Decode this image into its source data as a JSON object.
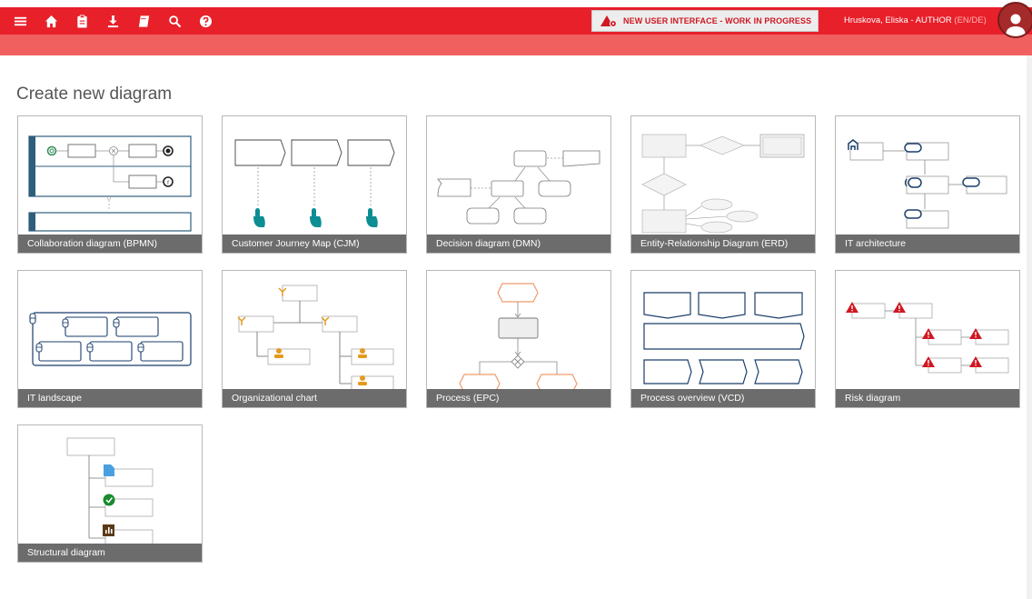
{
  "header": {
    "wip_text": "NEW USER INTERFACE - WORK IN PROGRESS",
    "user_name": "Hruskova, Eliska - AUTHOR",
    "user_lang": "(EN/DE)",
    "icons": [
      "menu-icon",
      "home-icon",
      "clipboard-icon",
      "download-icon",
      "book-icon",
      "search-icon",
      "help-icon"
    ],
    "colors": {
      "primary": "#e7202a",
      "secondary": "#f0605f",
      "avatar": "#a52a2a"
    }
  },
  "main": {
    "heading": "Create new diagram",
    "diagrams": [
      {
        "label": "Collaboration diagram (BPMN)"
      },
      {
        "label": "Customer Journey Map (CJM)"
      },
      {
        "label": "Decision diagram (DMN)"
      },
      {
        "label": "Entity-Relationship Diagram (ERD)"
      },
      {
        "label": "IT architecture"
      },
      {
        "label": "IT landscape"
      },
      {
        "label": "Organizational chart"
      },
      {
        "label": "Process (EPC)"
      },
      {
        "label": "Process overview (VCD)"
      },
      {
        "label": "Risk diagram"
      },
      {
        "label": "Structural diagram"
      }
    ]
  }
}
